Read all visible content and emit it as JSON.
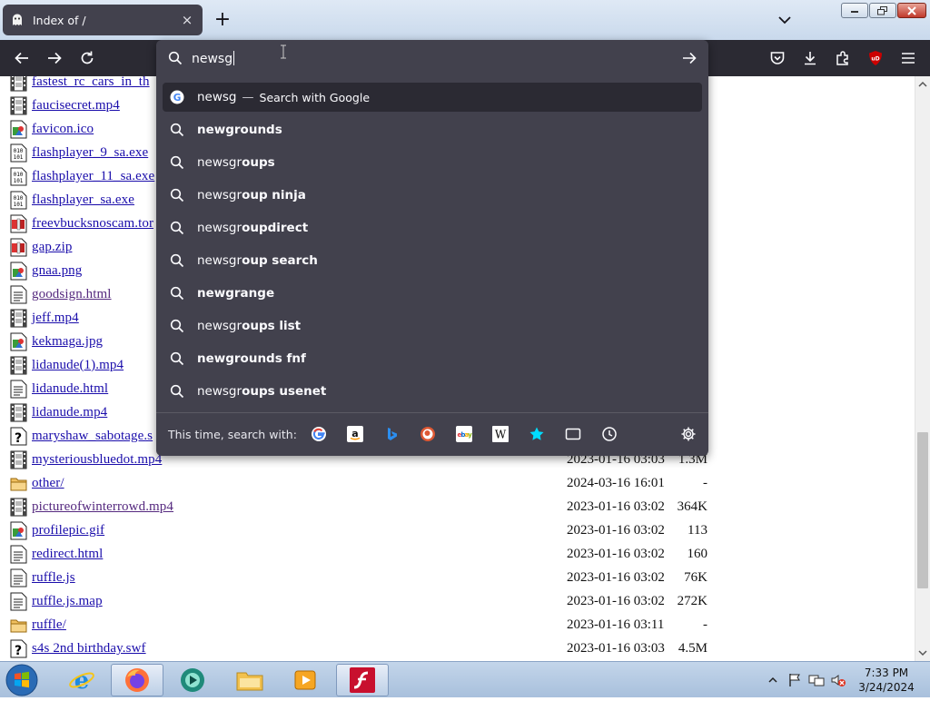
{
  "window": {
    "tab_title": "Index of /",
    "tab_close": "×",
    "new_tab": "+"
  },
  "urlbar": {
    "value": "newsg",
    "first_suggestion": {
      "query": "newsg",
      "separator": "—",
      "action": "Search with Google"
    },
    "suggestions": [
      {
        "prefix": "",
        "bold": "newgrounds"
      },
      {
        "prefix": "newsgr",
        "bold": "oups"
      },
      {
        "prefix": "newsgr",
        "bold": "oup ninja"
      },
      {
        "prefix": "newsgr",
        "bold": "oupdirect"
      },
      {
        "prefix": "newsgr",
        "bold": "oup search"
      },
      {
        "prefix": "",
        "bold": "newgrange"
      },
      {
        "prefix": "newsgr",
        "bold": "oups list"
      },
      {
        "prefix": "",
        "bold": "newgrounds fnf"
      },
      {
        "prefix": "newsgr",
        "bold": "oups usenet"
      }
    ],
    "one_off_label": "This time, search with:",
    "engines": [
      "google",
      "amazon",
      "bing",
      "duckduckgo",
      "ebay",
      "wikipedia",
      "bookmarks",
      "tabs",
      "history"
    ]
  },
  "listing": [
    {
      "name": "fastest_rc_cars_in_th",
      "type": "video",
      "date": "",
      "size": ""
    },
    {
      "name": "faucisecret.mp4",
      "type": "video",
      "date": "",
      "size": ""
    },
    {
      "name": "favicon.ico",
      "type": "image",
      "date": "",
      "size": ""
    },
    {
      "name": "flashplayer_9_sa.exe",
      "type": "binary",
      "date": "",
      "size": ""
    },
    {
      "name": "flashplayer_11_sa.exe",
      "type": "binary",
      "date": "",
      "size": ""
    },
    {
      "name": "flashplayer_sa.exe",
      "type": "binary",
      "date": "",
      "size": ""
    },
    {
      "name": "freevbucksnoscam.tor",
      "type": "compressed",
      "date": "",
      "size": ""
    },
    {
      "name": "gap.zip",
      "type": "compressed",
      "date": "",
      "size": ""
    },
    {
      "name": "gnaa.png",
      "type": "image",
      "date": "",
      "size": ""
    },
    {
      "name": "goodsign.html",
      "type": "text",
      "date": "",
      "size": ""
    },
    {
      "name": "jeff.mp4",
      "type": "video",
      "date": "",
      "size": ""
    },
    {
      "name": "kekmaga.jpg",
      "type": "image",
      "date": "",
      "size": ""
    },
    {
      "name": "lidanude(1).mp4",
      "type": "video",
      "date": "",
      "size": ""
    },
    {
      "name": "lidanude.html",
      "type": "text",
      "date": "",
      "size": ""
    },
    {
      "name": "lidanude.mp4",
      "type": "video",
      "date": "",
      "size": ""
    },
    {
      "name": "maryshaw_sabotage.s",
      "type": "unknown",
      "date": "",
      "size": ""
    },
    {
      "name": "mysteriousbluedot.mp4",
      "type": "video",
      "date": "2023-01-16 03:03",
      "size": "1.3M"
    },
    {
      "name": "other/",
      "type": "folder",
      "date": "2024-03-16 16:01",
      "size": "-"
    },
    {
      "name": "pictureofwinterrowd.mp4",
      "type": "video",
      "date": "2023-01-16 03:02",
      "size": "364K"
    },
    {
      "name": "profilepic.gif",
      "type": "image",
      "date": "2023-01-16 03:02",
      "size": "113"
    },
    {
      "name": "redirect.html",
      "type": "text",
      "date": "2023-01-16 03:02",
      "size": "160"
    },
    {
      "name": "ruffle.js",
      "type": "text",
      "date": "2023-01-16 03:02",
      "size": "76K"
    },
    {
      "name": "ruffle.js.map",
      "type": "text",
      "date": "2023-01-16 03:02",
      "size": "272K"
    },
    {
      "name": "ruffle/",
      "type": "folder",
      "date": "2023-01-16 03:11",
      "size": "-"
    },
    {
      "name": "s4s 2nd birthday.swf",
      "type": "unknown",
      "date": "2023-01-16 03:03",
      "size": "4.5M"
    }
  ],
  "taskbar": {
    "time": "7:33 PM",
    "date": "3/24/2024"
  }
}
